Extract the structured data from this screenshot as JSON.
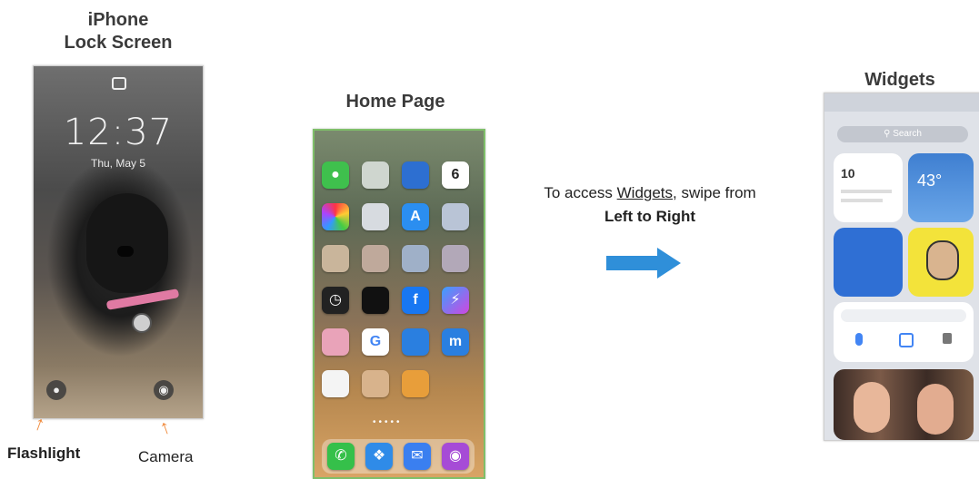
{
  "lock_screen": {
    "title_line1": "iPhone",
    "title_line2": "Lock Screen",
    "time": "12:37",
    "date": "Thu, May 5",
    "flashlight_label": "Flashlight",
    "camera_label": "Camera"
  },
  "home_page": {
    "title": "Home Page",
    "calendar_day": "6"
  },
  "instruction": {
    "prefix": "To access ",
    "link_word": "Widgets",
    "middle": ", swipe from",
    "direction": "Left to Right"
  },
  "widgets": {
    "title": "Widgets",
    "search_placeholder": "Search",
    "calendar_date": "10",
    "weather_temp": "43°",
    "arrow_color": "#2f8fd9",
    "accent_orange": "#f08a3c"
  }
}
